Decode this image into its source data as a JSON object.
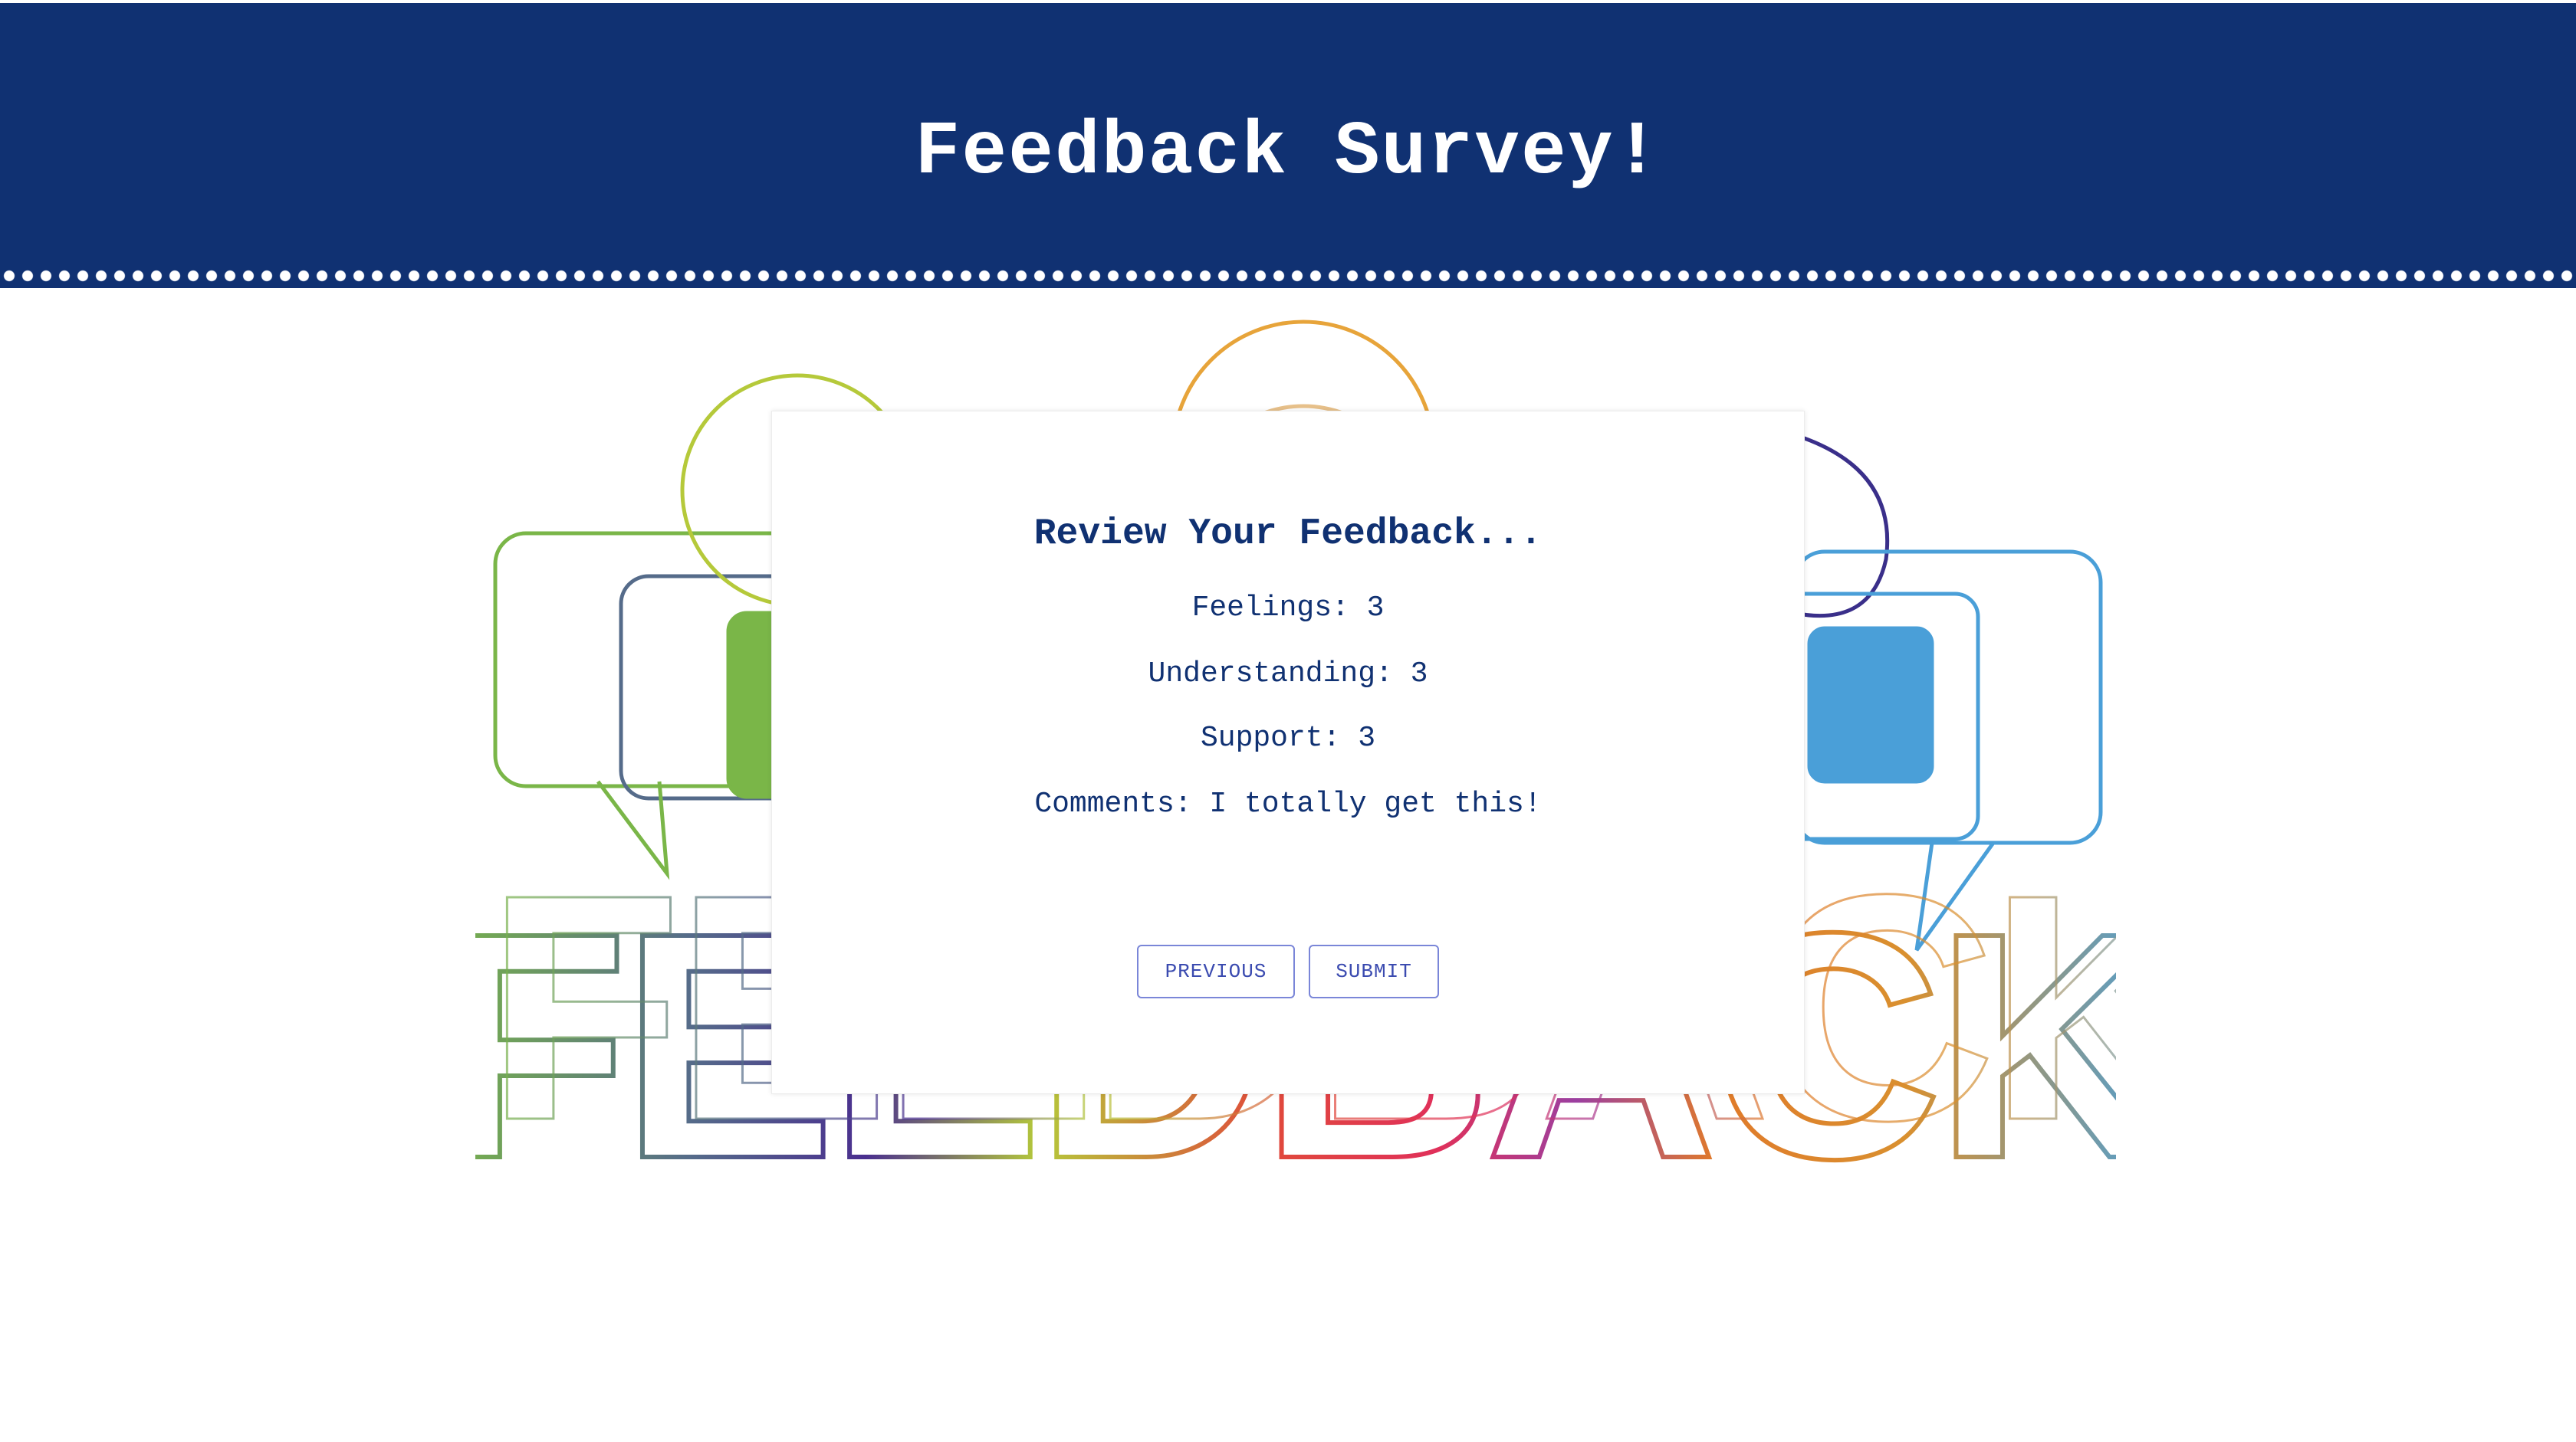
{
  "header": {
    "title": "Feedback Survey!"
  },
  "review": {
    "title": "Review Your Feedback...",
    "feelings_label": "Feelings:",
    "feelings_value": "3",
    "understanding_label": "Understanding:",
    "understanding_value": "3",
    "support_label": "Support:",
    "support_value": "3",
    "comments_label": "Comments:",
    "comments_value": "I totally get this!"
  },
  "buttons": {
    "previous_label": "PREVIOUS",
    "submit_label": "SUBMIT"
  },
  "background_art": {
    "word": "FEEDBACK"
  },
  "colors": {
    "header_bg": "#103172",
    "accent_text": "#103172",
    "button_border": "#7a86d8",
    "button_text": "#3b4bb0"
  }
}
